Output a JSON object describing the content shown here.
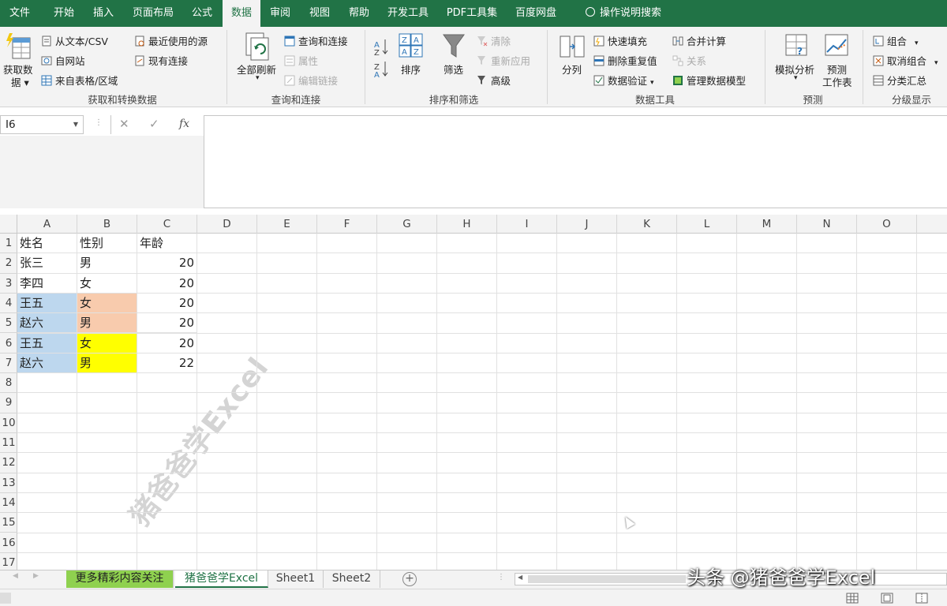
{
  "ribbon_tabs": [
    "文件",
    "开始",
    "插入",
    "页面布局",
    "公式",
    "数据",
    "审阅",
    "视图",
    "帮助",
    "开发工具",
    "PDF工具集",
    "百度网盘"
  ],
  "active_tab": "数据",
  "tell_me": "操作说明搜索",
  "groups": {
    "get": {
      "big_label": "获取数",
      "big_label2": "据",
      "items": [
        "从文本/CSV",
        "自网站",
        "来自表格/区域",
        "最近使用的源",
        "现有连接"
      ],
      "label": "获取和转换数据"
    },
    "query": {
      "big_label": "全部刷新",
      "items": [
        "查询和连接",
        "属性",
        "编辑链接"
      ],
      "label": "查询和连接"
    },
    "sort": {
      "sort_label": "排序",
      "filter_label": "筛选",
      "items": [
        "清除",
        "重新应用",
        "高级"
      ],
      "label": "排序和筛选"
    },
    "tools": {
      "big_label": "分列",
      "items": [
        "快速填充",
        "删除重复值",
        "数据验证",
        "合并计算",
        "关系",
        "管理数据模型"
      ],
      "label": "数据工具"
    },
    "forecast": {
      "whatif": "模拟分析",
      "sheet1": "预测",
      "sheet2": "工作表",
      "label": "预测"
    },
    "outline": {
      "items": [
        "组合",
        "取消组合",
        "分类汇总"
      ],
      "label": "分级显示"
    }
  },
  "namebox": "I6",
  "formula_icons": [
    "✕",
    "✓",
    "fx"
  ],
  "columns": [
    "A",
    "B",
    "C",
    "D",
    "E",
    "F",
    "G",
    "H",
    "I",
    "J",
    "K",
    "L",
    "M",
    "N",
    "O"
  ],
  "rows": [
    "1",
    "2",
    "3",
    "4",
    "5",
    "6",
    "7",
    "8",
    "9",
    "10",
    "11",
    "12",
    "13",
    "14",
    "15",
    "16",
    "17"
  ],
  "table": {
    "header": [
      "姓名",
      "性别",
      "年龄"
    ],
    "data": [
      [
        "张三",
        "男",
        "20"
      ],
      [
        "李四",
        "女",
        "20"
      ],
      [
        "王五",
        "女",
        "20"
      ],
      [
        "赵六",
        "男",
        "20"
      ],
      [
        "王五",
        "女",
        "20"
      ],
      [
        "赵六",
        "男",
        "22"
      ]
    ]
  },
  "colors": {
    "excel_green": "#217346",
    "blue_fill": "#bdd7ee",
    "peach_fill": "#f8cbad",
    "yellow_fill": "#ffff00",
    "green_tab": "#8fd14f"
  },
  "watermark": "猪爸爸学Excel",
  "sheets": [
    "更多精彩内容关注",
    "猪爸爸学Excel",
    "Sheet1",
    "Sheet2"
  ],
  "active_sheet": "猪爸爸学Excel",
  "overlay_text": "头条 @猪爸爸学Excel"
}
